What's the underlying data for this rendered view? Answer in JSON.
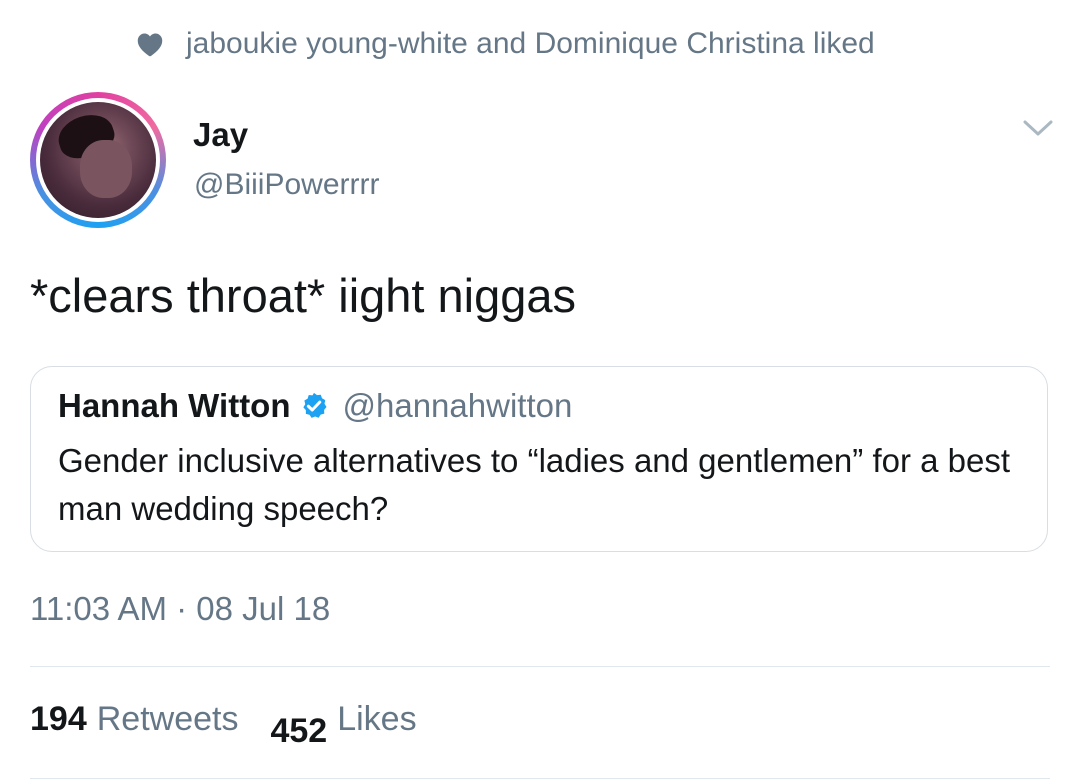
{
  "social_context": {
    "icon": "heart-icon",
    "text": "jaboukie young-white and Dominique Christina liked"
  },
  "author": {
    "display_name": "Jay",
    "handle": "@BiiiPowerrrr"
  },
  "tweet": {
    "text": "*clears throat* iight niggas",
    "timestamp": "11:03 AM · 08 Jul 18"
  },
  "quoted_tweet": {
    "display_name": "Hannah Witton",
    "handle": "@hannahwitton",
    "verified_icon": "verified-badge-icon",
    "text": "Gender inclusive alternatives to “ladies and gentlemen” for a best man wedding speech?"
  },
  "stats": {
    "retweets_count": "194",
    "retweets_label": "Retweets",
    "likes_count": "452",
    "likes_label": "Likes"
  },
  "colors": {
    "text_primary": "#14171a",
    "text_secondary": "#657786",
    "verified_blue": "#1da1f2",
    "border": "#d8dee3"
  }
}
